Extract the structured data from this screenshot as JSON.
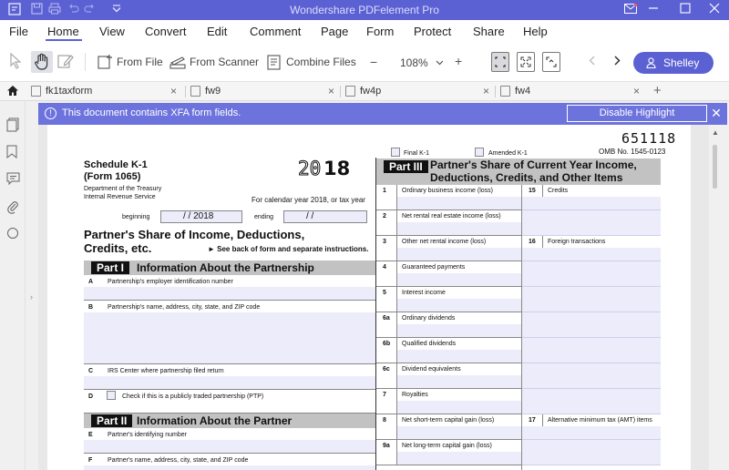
{
  "window": {
    "title": "Wondershare PDFelement Pro"
  },
  "menu": {
    "items": [
      "File",
      "Home",
      "View",
      "Convert",
      "Edit",
      "Comment",
      "Page",
      "Form",
      "Protect",
      "Share",
      "Help"
    ],
    "active": "Home"
  },
  "toolbar": {
    "from_file": "From File",
    "from_scanner": "From Scanner",
    "combine_files": "Combine Files",
    "zoom": "108%",
    "zoom_out": "−",
    "zoom_in": "+",
    "user": "Shelley"
  },
  "tabs": [
    {
      "label": "fk1taxform",
      "close": "×"
    },
    {
      "label": "fw9",
      "close": "×"
    },
    {
      "label": "fw4p",
      "close": "×"
    },
    {
      "label": "fw4",
      "close": "×"
    }
  ],
  "new_tab": "+",
  "notice": {
    "icon": "!",
    "message": "This document contains XFA form fields.",
    "button": "Disable Highlight",
    "close": "✕"
  },
  "form": {
    "omb_code": "651118",
    "omb_no": "OMB No. 1545-0123",
    "final_k1": "Final K-1",
    "amended_k1": "Amended K-1",
    "schedule": "Schedule K-1",
    "form_no": "(Form 1065)",
    "dept": "Department of the Treasury",
    "irs": "Internal Revenue Service",
    "year_prefix": "20",
    "year_suffix": "18",
    "calendar_year": "For calendar year 2018, or tax year",
    "beginning": "beginning",
    "beginning_value": "/        /  2018",
    "ending": "ending",
    "ending_value": "/        /",
    "title_line1": "Partner's Share of Income, Deductions,",
    "title_line2": "Credits, etc.",
    "see_back": "► See back of form and separate instructions.",
    "part1_tag": "Part I",
    "part1_title": "Information About the Partnership",
    "a_letter": "A",
    "a_label": "Partnership's employer identification number",
    "b_letter": "B",
    "b_label": "Partnership's name, address, city, state, and ZIP code",
    "c_letter": "C",
    "c_label": "IRS Center where partnership filed return",
    "d_letter": "D",
    "d_label": "Check if this is a publicly traded partnership (PTP)",
    "part2_tag": "Part II",
    "part2_title": "Information About the Partner",
    "e_letter": "E",
    "e_label": "Partner's identifying number",
    "f_letter": "F",
    "f_label": "Partner's name, address, city, state, and ZIP code",
    "part3_tag": "Part III",
    "part3_title_line1": "Partner's Share of Current Year Income,",
    "part3_title_line2": "Deductions, Credits, and Other Items",
    "lines": [
      {
        "no": "1",
        "label": "Ordinary business income (loss)"
      },
      {
        "no": "2",
        "label": "Net rental real estate income (loss)"
      },
      {
        "no": "3",
        "label": "Other net rental income (loss)"
      },
      {
        "no": "4",
        "label": "Guaranteed payments"
      },
      {
        "no": "5",
        "label": "Interest income"
      },
      {
        "no": "6a",
        "label": "Ordinary dividends"
      },
      {
        "no": "6b",
        "label": "Qualified dividends"
      },
      {
        "no": "6c",
        "label": "Dividend equivalents"
      },
      {
        "no": "7",
        "label": "Royalties"
      },
      {
        "no": "8",
        "label": "Net short-term capital gain (loss)"
      },
      {
        "no": "9a",
        "label": "Net long-term capital gain (loss)"
      }
    ],
    "right_lines": [
      {
        "no": "15",
        "label": "Credits"
      },
      {
        "no": "16",
        "label": "Foreign transactions"
      },
      {
        "no": "17",
        "label": "Alternative minimum tax (AMT) items"
      }
    ]
  }
}
